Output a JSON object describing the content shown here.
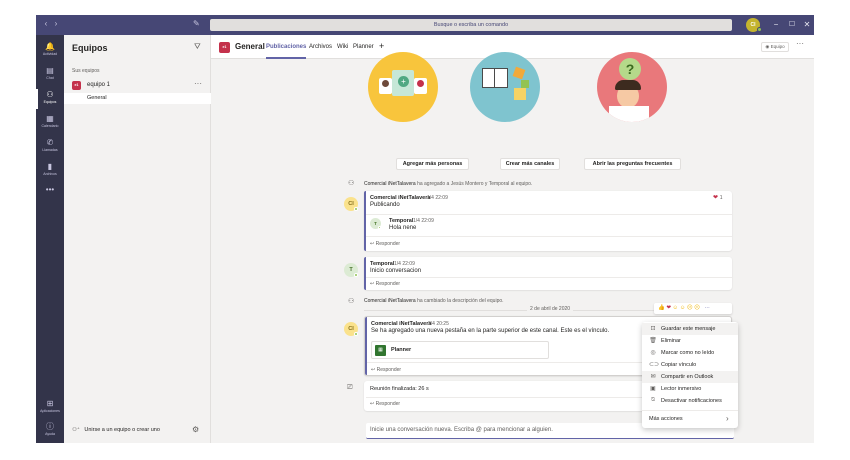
{
  "titlebar": {
    "search_placeholder": "Busque o escriba un comando",
    "user_initials": "CI"
  },
  "rail": [
    {
      "label": "Actividad",
      "icon": "bell-icon",
      "glyph": "🔔"
    },
    {
      "label": "Chat",
      "icon": "chat-icon",
      "glyph": "▤"
    },
    {
      "label": "Equipos",
      "icon": "teams-icon",
      "glyph": "⚇"
    },
    {
      "label": "Calendario",
      "icon": "calendar-icon",
      "glyph": "▦"
    },
    {
      "label": "Llamadas",
      "icon": "phone-icon",
      "glyph": "✆"
    },
    {
      "label": "Archivos",
      "icon": "file-icon",
      "glyph": "▮"
    }
  ],
  "rail_bottom": {
    "apps_label": "Aplicaciones",
    "help_label": "Ayuda"
  },
  "teams_panel": {
    "title": "Equipos",
    "section_label": "Sus equipos",
    "team": {
      "initials": "e1",
      "name": "equipo 1"
    },
    "channel": "General",
    "join_label": "Unirse a un equipo o crear uno"
  },
  "header": {
    "initials": "e1",
    "channel": "General",
    "tabs": [
      "Publicaciones",
      "Archivos",
      "Wiki",
      "Planner"
    ],
    "team_button": "Equipo"
  },
  "welcome": {
    "buttons": [
      "Agregar más personas",
      "Crear más canales",
      "Abrir las preguntas frecuentes"
    ]
  },
  "feed": {
    "system1": {
      "actor": "Comercial iNetTalavera",
      "text": " ha agregado a Jesús Montero y Temporal al equipo."
    },
    "post1": {
      "author": "Comercial iNetTalavera",
      "time": "1/4 22:09",
      "body": "Publicando",
      "initials": "CI",
      "likes": "1",
      "reply": {
        "author": "Temporal",
        "time": "1/4 22:09",
        "body": "Hola nene",
        "initials": "T"
      },
      "reply_label": "Responder"
    },
    "post2": {
      "author": "Temporal",
      "time": "1/4 22:09",
      "body": "Inicio conversacion",
      "initials": "T",
      "reply_label": "Responder"
    },
    "system2": {
      "actor": "Comercial iNetTalavera",
      "text": " ha cambiado la descripción del equipo."
    },
    "date_divider": "2 de abril de 2020",
    "post3": {
      "author": "Comercial iNetTalavera",
      "time": "2/4 20:25",
      "body": "Se ha agregado una nueva pestaña en la parte superior de este canal. Este es el vínculo.",
      "initials": "CI",
      "tab_card": "Planner",
      "reply_label": "Responder"
    },
    "meeting": {
      "text": "Reunión finalizada: 26 s",
      "reply_label": "Responder"
    }
  },
  "context_menu": [
    {
      "label": "Guardar este mensaje",
      "icon": "bookmark-icon",
      "glyph": "⊡"
    },
    {
      "label": "Eliminar",
      "icon": "trash-icon",
      "glyph": "🗑"
    },
    {
      "label": "Marcar como no leído",
      "icon": "unread-icon",
      "glyph": "◎"
    },
    {
      "label": "Copiar vínculo",
      "icon": "link-icon",
      "glyph": "⊂⊃"
    },
    {
      "label": "Compartir en Outlook",
      "icon": "mail-icon",
      "glyph": "✉"
    },
    {
      "label": "Lector inmersivo",
      "icon": "reader-icon",
      "glyph": "▣"
    },
    {
      "label": "Desactivar notificaciones",
      "icon": "bell-off-icon",
      "glyph": "⍉"
    },
    {
      "label": "Más acciones",
      "icon": "chevron-right-icon",
      "glyph": "›"
    }
  ],
  "compose": {
    "placeholder": "Inicie una conversación nueva. Escriba @ para mencionar a alguien."
  }
}
